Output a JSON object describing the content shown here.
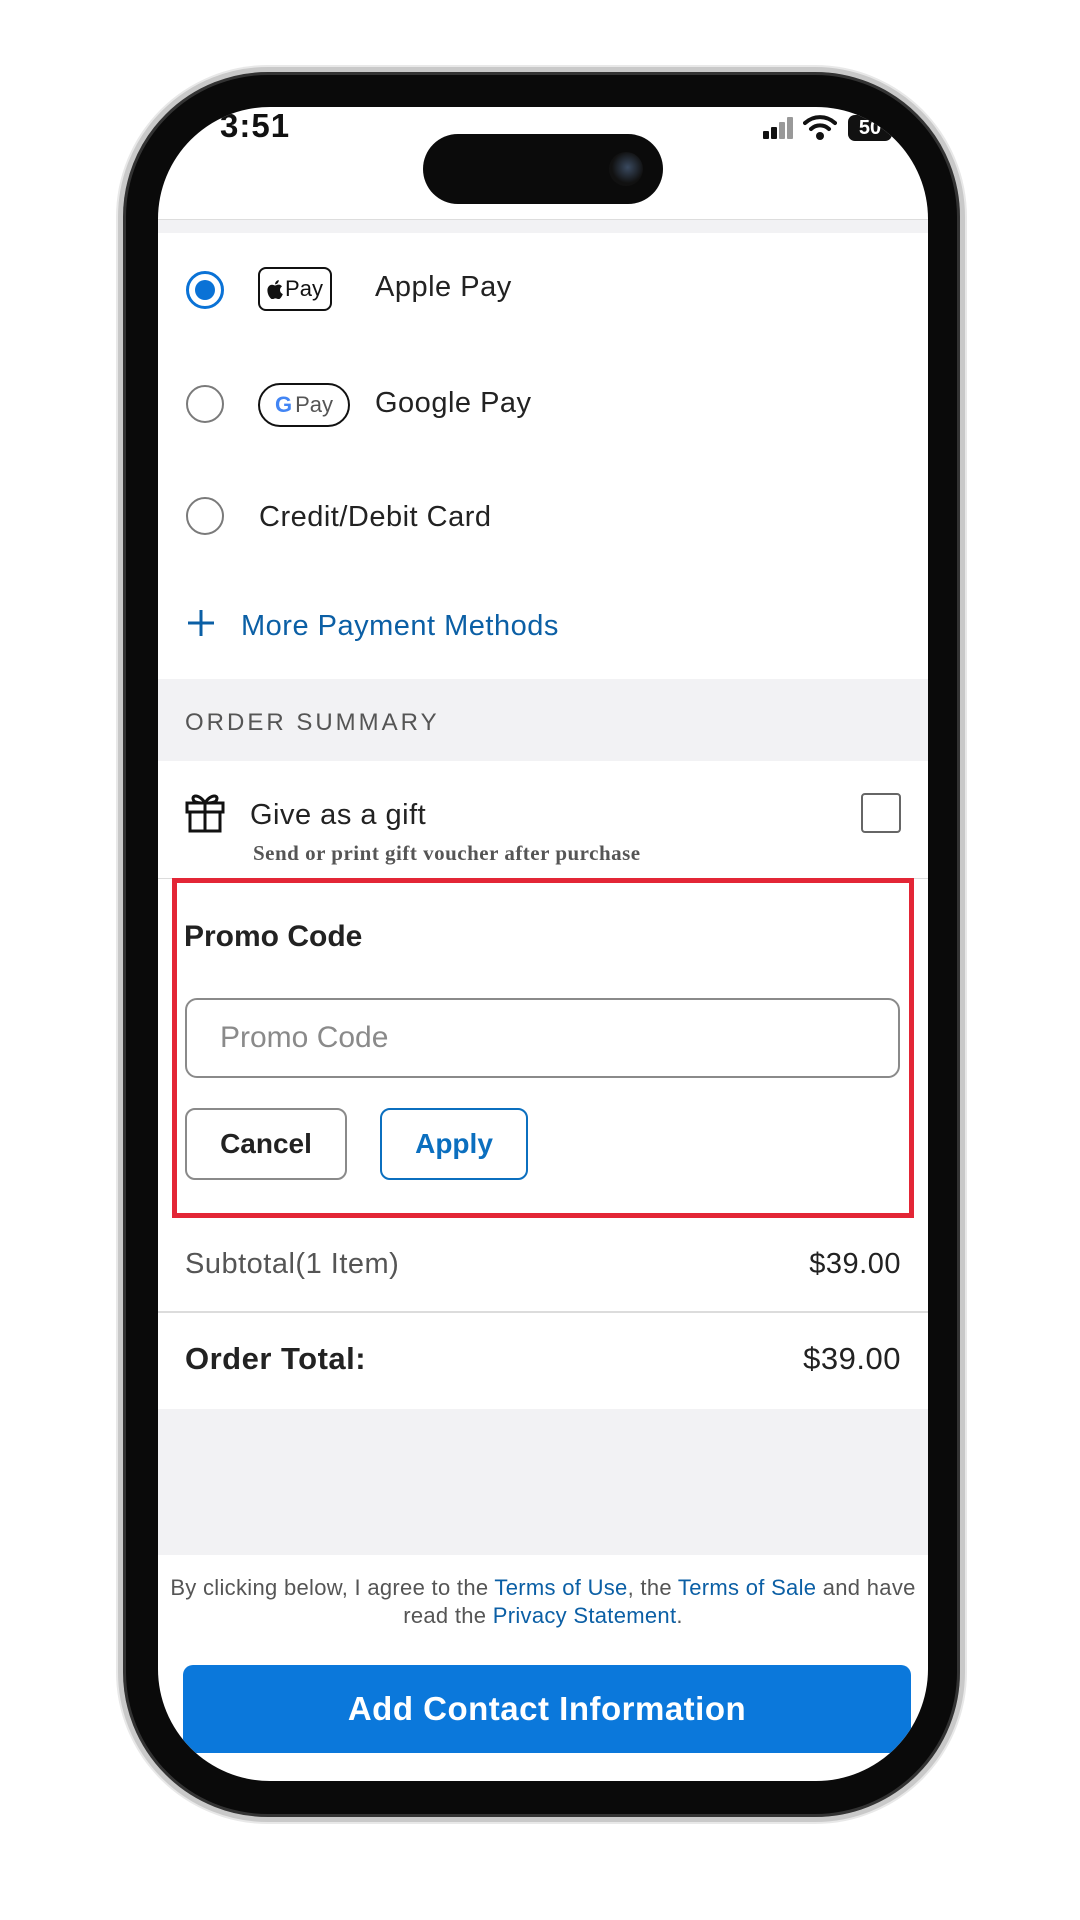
{
  "status_bar": {
    "time": "3:51",
    "battery": "50"
  },
  "payment_methods": [
    {
      "label": "Apple Pay",
      "icon_text": "Pay",
      "icon": "apple-pay-icon",
      "selected": true
    },
    {
      "label": "Google Pay",
      "icon_text": "Pay",
      "icon": "google-pay-icon",
      "selected": false
    },
    {
      "label": "Credit/Debit Card",
      "selected": false
    }
  ],
  "more_payment": {
    "plus": "+",
    "label": "More Payment Methods"
  },
  "order_summary": {
    "title": "ORDER SUMMARY",
    "gift_label": "Give as a gift",
    "gift_sub": "Send or print gift voucher after purchase"
  },
  "promo": {
    "title": "Promo Code",
    "placeholder": "Promo Code",
    "value": "",
    "cancel_label": "Cancel",
    "apply_label": "Apply"
  },
  "totals": {
    "subtotal_label": "Subtotal(1 Item)",
    "subtotal_value": "$39.00",
    "total_label": "Order Total:",
    "total_value": "$39.00"
  },
  "terms": {
    "prefix": "By clicking below, I agree to the ",
    "terms_of_use": "Terms of Use",
    "mid1": ", the ",
    "terms_of_sale": "Terms of Sale",
    "mid2": " and have read the ",
    "privacy": "Privacy Statement",
    "suffix": "."
  },
  "cta_label": "Add Contact Information",
  "colors": {
    "accent": "#0b78db",
    "link": "#0b5fa5",
    "highlight": "#e32636"
  }
}
